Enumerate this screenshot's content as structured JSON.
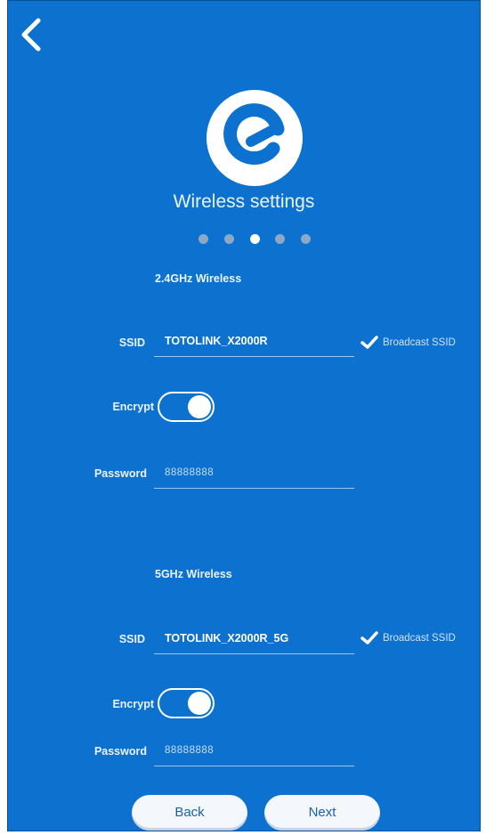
{
  "header": {
    "back_icon": "chevron-left-icon",
    "logo_icon": "brand-logo-icon",
    "title": "Wireless settings"
  },
  "stepper": {
    "total_steps": 5,
    "current_step": 3
  },
  "band_24": {
    "section_title": "2.4GHz Wireless",
    "ssid_label": "SSID",
    "ssid_value": "TOTOLINK_X2000R",
    "broadcast_label": "Broadcast SSID",
    "broadcast_checked": true,
    "encrypt_label": "Encrypt",
    "encrypt_on": true,
    "password_label": "Password",
    "password_value": "88888888"
  },
  "band_5": {
    "section_title": "5GHz Wireless",
    "ssid_label": "SSID",
    "ssid_value": "TOTOLINK_X2000R_5G",
    "broadcast_label": "Broadcast SSID",
    "broadcast_checked": true,
    "encrypt_label": "Encrypt",
    "encrypt_on": true,
    "password_label": "Password",
    "password_value": "88888888"
  },
  "footer": {
    "back_label": "Back",
    "next_label": "Next"
  },
  "colors": {
    "background": "#0d72cf",
    "text": "#ffffff",
    "button": "#f4f7fb",
    "button_text": "#1b5fae"
  }
}
